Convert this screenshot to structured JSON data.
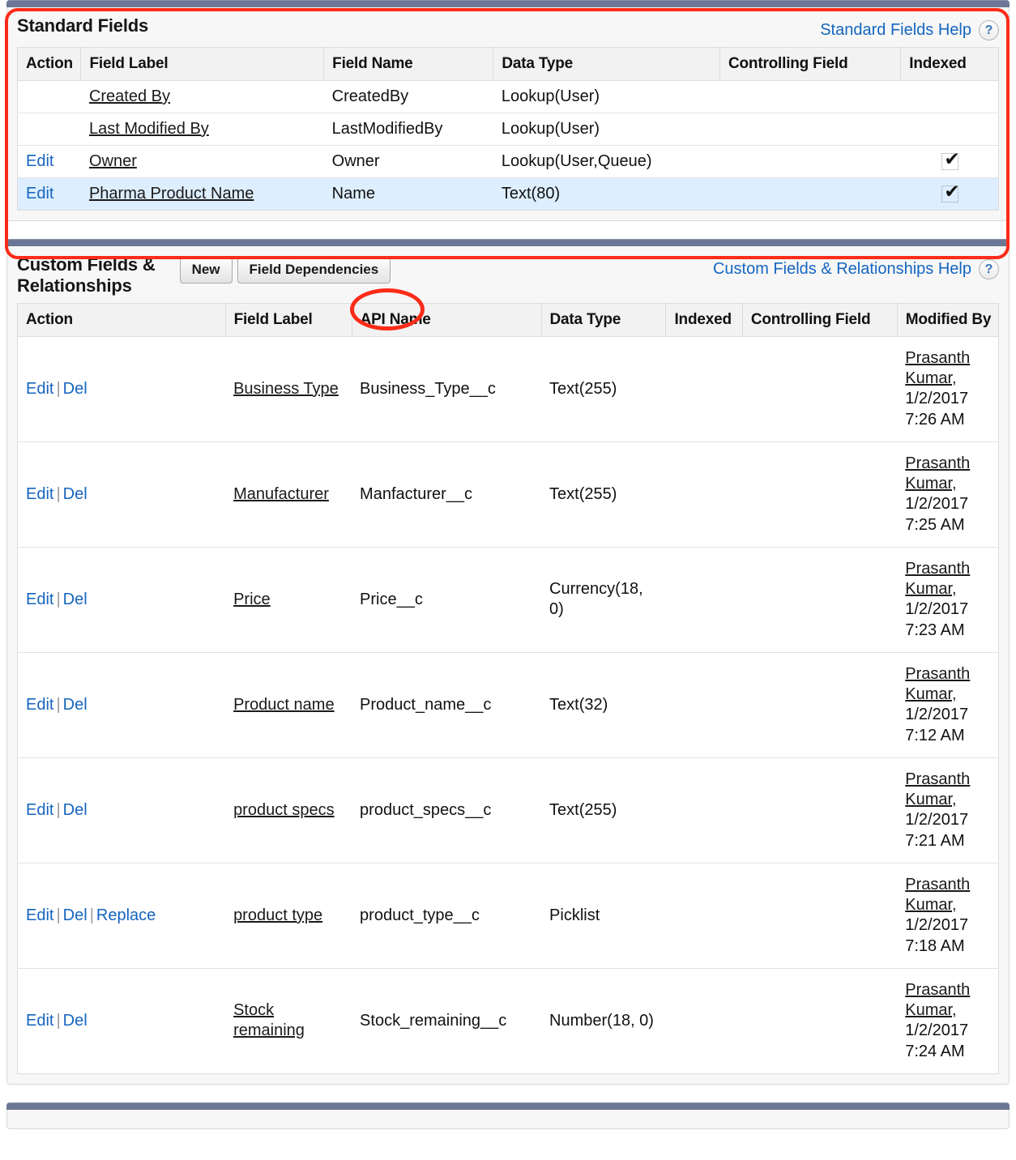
{
  "standard_fields": {
    "title": "Standard Fields",
    "help_link": "Standard Fields Help",
    "help_icon": "question-mark-icon",
    "columns": [
      "Action",
      "Field Label",
      "Field Name",
      "Data Type",
      "Controlling Field",
      "Indexed"
    ],
    "rows": [
      {
        "action": "",
        "field_label": "Created By",
        "field_name": "CreatedBy",
        "data_type": "Lookup(User)",
        "controlling_field": "",
        "indexed": false,
        "highlight": false
      },
      {
        "action": "",
        "field_label": "Last Modified By",
        "field_name": "LastModifiedBy",
        "data_type": "Lookup(User)",
        "controlling_field": "",
        "indexed": false,
        "highlight": false
      },
      {
        "action": "Edit",
        "field_label": "Owner",
        "field_name": "Owner",
        "data_type": "Lookup(User,Queue)",
        "controlling_field": "",
        "indexed": true,
        "highlight": false
      },
      {
        "action": "Edit",
        "field_label": "Pharma Product Name",
        "field_name": "Name",
        "data_type": "Text(80)",
        "controlling_field": "",
        "indexed": true,
        "highlight": true
      }
    ]
  },
  "custom_fields": {
    "title": "Custom Fields &\nRelationships",
    "new_button": "New",
    "field_dependencies_button": "Field Dependencies",
    "help_link": "Custom Fields & Relationships Help",
    "help_icon": "question-mark-icon",
    "columns": [
      "Action",
      "Field Label",
      "API Name",
      "Data Type",
      "Indexed",
      "Controlling Field",
      "Modified By"
    ],
    "action_edit": "Edit",
    "action_del": "Del",
    "action_replace": "Replace",
    "rows": [
      {
        "actions": [
          "Edit",
          "Del"
        ],
        "field_label": "Business Type",
        "api_name": "Business_Type__c",
        "data_type": "Text(255)",
        "indexed": "",
        "controlling_field": "",
        "modified_by_name": "Prasanth Kumar,",
        "modified_by_date": "1/2/2017",
        "modified_by_time": "7:26 AM"
      },
      {
        "actions": [
          "Edit",
          "Del"
        ],
        "field_label": "Manufacturer",
        "api_name": "Manfacturer__c",
        "data_type": "Text(255)",
        "indexed": "",
        "controlling_field": "",
        "modified_by_name": "Prasanth Kumar,",
        "modified_by_date": "1/2/2017",
        "modified_by_time": "7:25 AM"
      },
      {
        "actions": [
          "Edit",
          "Del"
        ],
        "field_label": "Price",
        "api_name": "Price__c",
        "data_type": "Currency(18, 0)",
        "indexed": "",
        "controlling_field": "",
        "modified_by_name": "Prasanth Kumar,",
        "modified_by_date": "1/2/2017",
        "modified_by_time": "7:23 AM"
      },
      {
        "actions": [
          "Edit",
          "Del"
        ],
        "field_label": "Product name",
        "api_name": "Product_name__c",
        "data_type": "Text(32)",
        "indexed": "",
        "controlling_field": "",
        "modified_by_name": "Prasanth Kumar,",
        "modified_by_date": "1/2/2017",
        "modified_by_time": "7:12 AM"
      },
      {
        "actions": [
          "Edit",
          "Del"
        ],
        "field_label": "product specs",
        "api_name": "product_specs__c",
        "data_type": "Text(255)",
        "indexed": "",
        "controlling_field": "",
        "modified_by_name": "Prasanth Kumar,",
        "modified_by_date": "1/2/2017",
        "modified_by_time": "7:21 AM"
      },
      {
        "actions": [
          "Edit",
          "Del",
          "Replace"
        ],
        "field_label": "product type",
        "api_name": "product_type__c",
        "data_type": "Picklist",
        "indexed": "",
        "controlling_field": "",
        "modified_by_name": "Prasanth Kumar,",
        "modified_by_date": "1/2/2017",
        "modified_by_time": "7:18 AM"
      },
      {
        "actions": [
          "Edit",
          "Del"
        ],
        "field_label": "Stock remaining",
        "api_name": "Stock_remaining__c",
        "data_type": "Number(18, 0)",
        "indexed": "",
        "controlling_field": "",
        "modified_by_name": "Prasanth Kumar,",
        "modified_by_date": "1/2/2017",
        "modified_by_time": "7:24 AM"
      }
    ]
  },
  "colors": {
    "panel_bar": "#6b7794",
    "link": "#1565c0",
    "annotation_red": "#fc2b18",
    "row_highlight": "#ddeeff"
  }
}
